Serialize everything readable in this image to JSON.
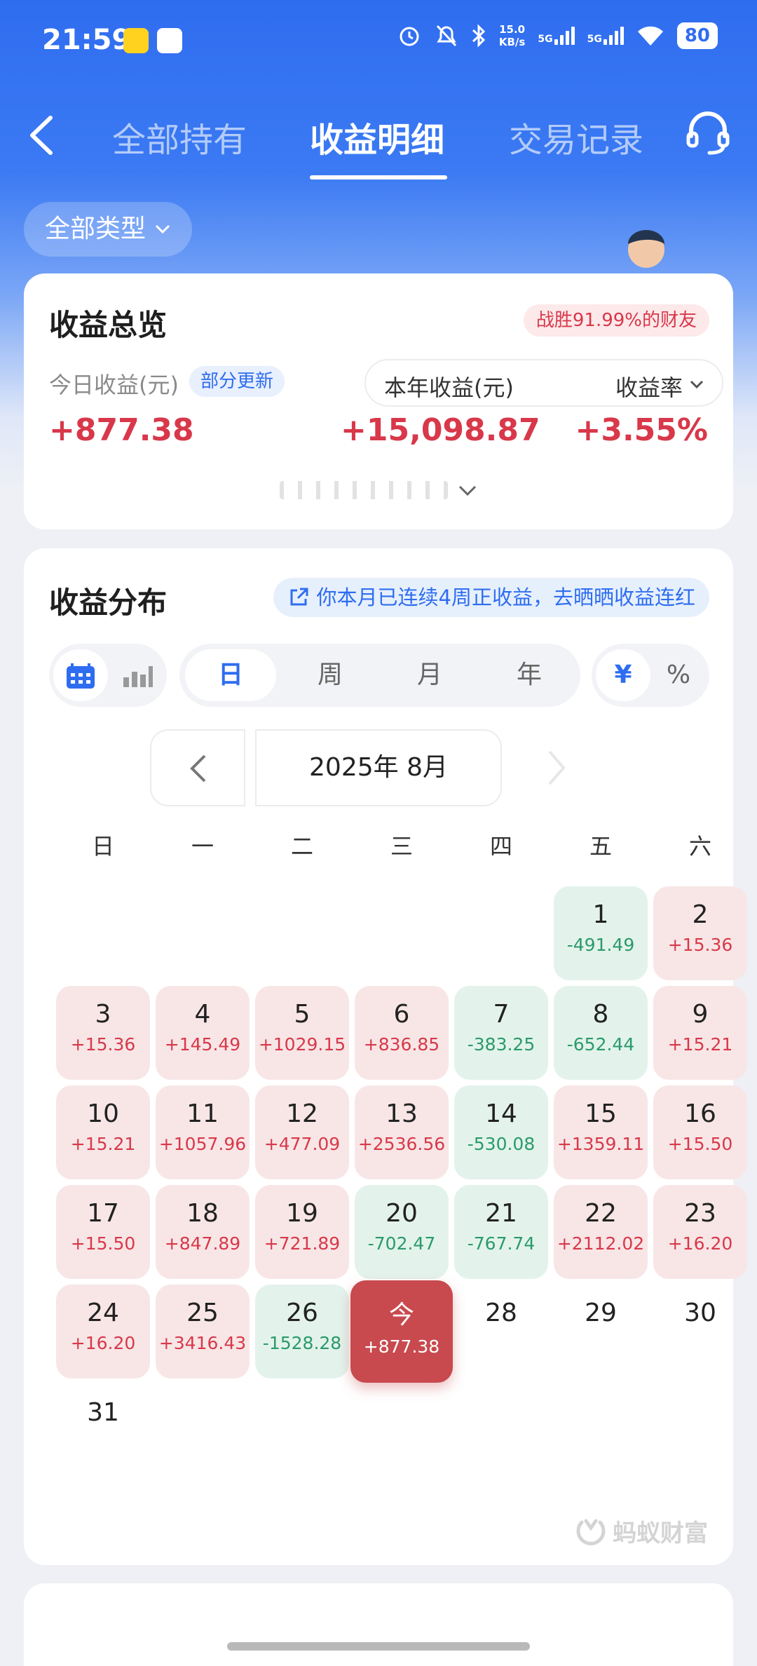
{
  "status_bar": {
    "time": "21:59",
    "speed_top": "15.0",
    "speed_bottom": "KB/s",
    "net1": "5G",
    "net2": "5G",
    "battery": "80"
  },
  "nav": {
    "tabs": [
      "全部持有",
      "收益明细",
      "交易记录"
    ],
    "active_tab": "收益明细"
  },
  "filter": {
    "label": "全部类型"
  },
  "overview": {
    "title": "收益总览",
    "beat_badge": "战胜91.99%的财友",
    "today_label": "今日收益(元)",
    "partial_badge": "部分更新",
    "year_label": "本年收益(元)",
    "rate_label": "收益率",
    "today_value": "+877.38",
    "year_value": "+15,098.87",
    "rate_value": "+3.55%"
  },
  "distribution": {
    "title": "收益分布",
    "streak_text": "你本月已连续4周正收益，去晒晒收益连红",
    "periods": [
      "日",
      "周",
      "月",
      "年"
    ],
    "active_period": "日",
    "units": [
      "¥",
      "%"
    ],
    "active_unit": "¥",
    "month": "2025年 8月",
    "weekdays": [
      "日",
      "一",
      "二",
      "三",
      "四",
      "五",
      "六"
    ],
    "days": [
      {
        "d": "1",
        "v": "-491.49",
        "t": "green"
      },
      {
        "d": "2",
        "v": "+15.36",
        "t": "red"
      },
      {
        "d": "3",
        "v": "+15.36",
        "t": "red"
      },
      {
        "d": "4",
        "v": "+145.49",
        "t": "red"
      },
      {
        "d": "5",
        "v": "+1029.15",
        "t": "red"
      },
      {
        "d": "6",
        "v": "+836.85",
        "t": "red"
      },
      {
        "d": "7",
        "v": "-383.25",
        "t": "green"
      },
      {
        "d": "8",
        "v": "-652.44",
        "t": "green"
      },
      {
        "d": "9",
        "v": "+15.21",
        "t": "red"
      },
      {
        "d": "10",
        "v": "+15.21",
        "t": "red"
      },
      {
        "d": "11",
        "v": "+1057.96",
        "t": "red"
      },
      {
        "d": "12",
        "v": "+477.09",
        "t": "red"
      },
      {
        "d": "13",
        "v": "+2536.56",
        "t": "red"
      },
      {
        "d": "14",
        "v": "-530.08",
        "t": "green"
      },
      {
        "d": "15",
        "v": "+1359.11",
        "t": "red"
      },
      {
        "d": "16",
        "v": "+15.50",
        "t": "red"
      },
      {
        "d": "17",
        "v": "+15.50",
        "t": "red"
      },
      {
        "d": "18",
        "v": "+847.89",
        "t": "red"
      },
      {
        "d": "19",
        "v": "+721.89",
        "t": "red"
      },
      {
        "d": "20",
        "v": "-702.47",
        "t": "green"
      },
      {
        "d": "21",
        "v": "-767.74",
        "t": "green"
      },
      {
        "d": "22",
        "v": "+2112.02",
        "t": "red"
      },
      {
        "d": "23",
        "v": "+16.20",
        "t": "red"
      },
      {
        "d": "24",
        "v": "+16.20",
        "t": "red"
      },
      {
        "d": "25",
        "v": "+3416.43",
        "t": "red"
      },
      {
        "d": "26",
        "v": "-1528.28",
        "t": "green"
      },
      {
        "d": "今",
        "v": "+877.38",
        "t": "today"
      },
      {
        "d": "28",
        "v": "",
        "t": "plain"
      },
      {
        "d": "29",
        "v": "",
        "t": "plain"
      },
      {
        "d": "30",
        "v": "",
        "t": "plain"
      },
      {
        "d": "31",
        "v": "",
        "t": "plain"
      }
    ],
    "first_weekday_index": 5,
    "watermark": "蚂蚁财富"
  },
  "colors": {
    "primary_blue": "#2f6df0",
    "gain_red": "#d8384a",
    "loss_green": "#2b9a6a",
    "today_red": "#c84a4e"
  }
}
